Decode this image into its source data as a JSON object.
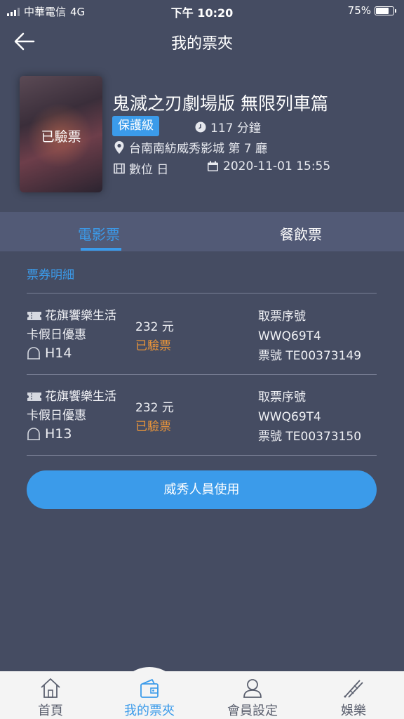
{
  "status_bar": {
    "carrier": "中華電信",
    "network": "4G",
    "time": "下午 10:20",
    "battery": "75%",
    "battery_level": 0.75
  },
  "header": {
    "title": "我的票夾"
  },
  "movie": {
    "poster_stamp": "已驗票",
    "title": "鬼滅之刃劇場版 無限列車篇",
    "rating": "保護級",
    "duration": "117 分鐘",
    "cinema": "台南南紡威秀影城 第 7 廳",
    "format": "數位 日",
    "datetime": "2020-11-01 15:55"
  },
  "tabs": [
    {
      "label": "電影票",
      "active": true
    },
    {
      "label": "餐飲票",
      "active": false
    }
  ],
  "section_label": "票券明細",
  "tickets": [
    {
      "name_line1": "花旗饗樂生活",
      "name_line2": "卡假日優惠",
      "seat": "H14",
      "price": "232 元",
      "status": "已驗票",
      "pickup_label": "取票序號",
      "pickup_code": "WWQ69T4",
      "ticket_no": "票號 TE00373149"
    },
    {
      "name_line1": "花旗饗樂生活",
      "name_line2": "卡假日優惠",
      "seat": "H13",
      "price": "232 元",
      "status": "已驗票",
      "pickup_label": "取票序號",
      "pickup_code": "WWQ69T4",
      "ticket_no": "票號 TE00373150"
    }
  ],
  "staff_button": "威秀人員使用",
  "nav": [
    {
      "label": "首頁",
      "icon": "home-icon"
    },
    {
      "label": "我的票夾",
      "icon": "wallet-icon",
      "active": true
    },
    {
      "label": "會員設定",
      "icon": "user-icon"
    },
    {
      "label": "娛樂",
      "icon": "entertainment-icon"
    }
  ],
  "colors": {
    "background": "#454c62",
    "accent": "#3b9bea",
    "status_orange": "#e8943a",
    "tab_bar": "#525a76",
    "nav_bg": "#f4f4f4"
  }
}
